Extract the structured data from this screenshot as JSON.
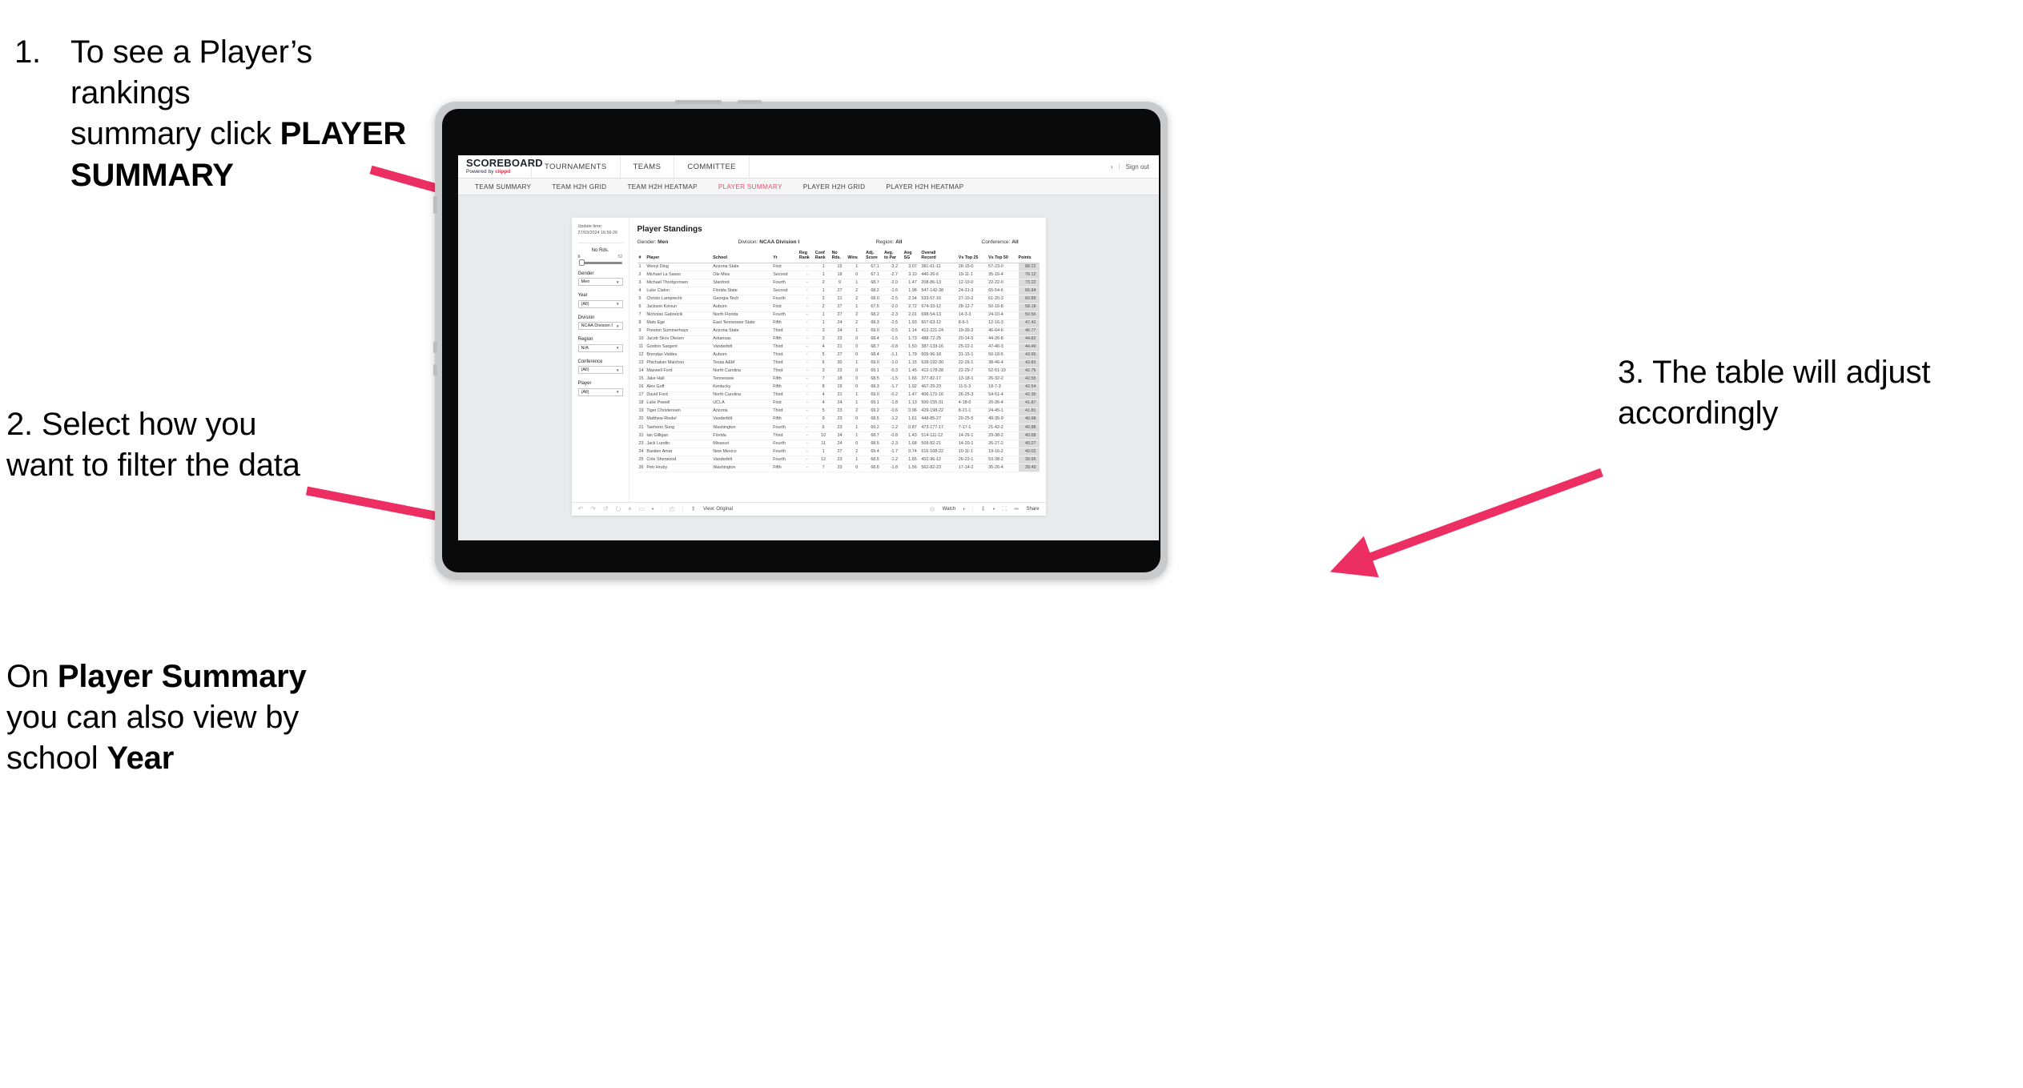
{
  "annotations": {
    "step1": {
      "number": "1.",
      "line1": "To see a Player’s rankings",
      "line2_pre": "summary click ",
      "line2_bold": "PLAYER",
      "line3_bold": "SUMMARY"
    },
    "step2": {
      "text": "2. Select how you want to filter the data"
    },
    "step2b": {
      "pre": "On ",
      "bold1": "Player Summary",
      "mid": " you can also view by school ",
      "bold2": "Year"
    },
    "step3": {
      "text": "3. The table will adjust accordingly"
    }
  },
  "colors": {
    "arrow": "#ED2E62",
    "accent": "#EF4D6E",
    "brand": "#E8334A"
  },
  "app": {
    "logo": {
      "main": "SCOREBOARD",
      "sub_pre": "Powered by ",
      "sub_brand": "clippd"
    },
    "top_nav": [
      "TOURNAMENTS",
      "TEAMS",
      "COMMITTEE"
    ],
    "header_right": {
      "user_glyph": "›",
      "divider": "|",
      "sign_out": "Sign out"
    },
    "sub_nav": [
      {
        "label": "TEAM SUMMARY",
        "active": false
      },
      {
        "label": "TEAM H2H GRID",
        "active": false
      },
      {
        "label": "TEAM H2H HEATMAP",
        "active": false
      },
      {
        "label": "PLAYER SUMMARY",
        "active": true
      },
      {
        "label": "PLAYER H2H GRID",
        "active": false
      },
      {
        "label": "PLAYER H2H HEATMAP",
        "active": false
      }
    ]
  },
  "filters": {
    "update_time_label": "Update time:",
    "update_time_value": "27/03/2024 16:56:26",
    "no_rds": {
      "label": "No Rds.",
      "min": "6",
      "max": "52"
    },
    "gender": {
      "label": "Gender",
      "value": "Men"
    },
    "year": {
      "label": "Year",
      "value": "(All)"
    },
    "division": {
      "label": "Division",
      "value": "NCAA Division I"
    },
    "region": {
      "label": "Region",
      "value": "N/A"
    },
    "conference": {
      "label": "Conference",
      "value": "(All)"
    },
    "player": {
      "label": "Player",
      "value": "(All)"
    }
  },
  "table": {
    "title": "Player Standings",
    "meta": [
      {
        "label": "Gender:",
        "value": "Men"
      },
      {
        "label": "Division:",
        "value": "NCAA Division I"
      },
      {
        "label": "Region:",
        "value": "All"
      },
      {
        "label": "Conference:",
        "value": "All"
      }
    ],
    "columns": [
      {
        "l1": "#",
        "l2": ""
      },
      {
        "l1": "Player",
        "l2": ""
      },
      {
        "l1": "School",
        "l2": ""
      },
      {
        "l1": "Yr",
        "l2": ""
      },
      {
        "l1": "Reg",
        "l2": "Rank"
      },
      {
        "l1": "Conf",
        "l2": "Rank"
      },
      {
        "l1": "No",
        "l2": "Rds."
      },
      {
        "l1": "Wins",
        "l2": ""
      },
      {
        "l1": "Adj.",
        "l2": "Score"
      },
      {
        "l1": "Avg.",
        "l2": "to Par"
      },
      {
        "l1": "Avg",
        "l2": "SG"
      },
      {
        "l1": "Overall",
        "l2": "Record"
      },
      {
        "l1": "Vs Top 25",
        "l2": ""
      },
      {
        "l1": "Vs Top 50",
        "l2": ""
      },
      {
        "l1": "Points",
        "l2": ""
      }
    ],
    "rows": [
      [
        "1",
        "Wenyi Ding",
        "Arizona State",
        "First",
        "-",
        "1",
        "15",
        "1",
        "67.1",
        "-3.2",
        "3.07",
        "381-61-11",
        "28-15-0",
        "57-23-0",
        "88.22"
      ],
      [
        "2",
        "Michael La Sasso",
        "Ole Miss",
        "Second",
        "-",
        "1",
        "18",
        "0",
        "67.1",
        "-2.7",
        "3.10",
        "440-26-6",
        "19-11-1",
        "35-16-4",
        "76.12"
      ],
      [
        "3",
        "Michael Thorbjornsen",
        "Stanford",
        "Fourth",
        "-",
        "2",
        "9",
        "1",
        "68.7",
        "-2.0",
        "1.47",
        "208-86-13",
        "12-10-0",
        "22-22-0",
        "73.22"
      ],
      [
        "4",
        "Luke Claton",
        "Florida State",
        "Second",
        "-",
        "1",
        "27",
        "2",
        "68.2",
        "-1.6",
        "1.98",
        "547-142-38",
        "24-31-3",
        "65-54-6",
        "66.94"
      ],
      [
        "5",
        "Christo Lamprecht",
        "Georgia Tech",
        "Fourth",
        "-",
        "2",
        "21",
        "2",
        "68.0",
        "-2.5",
        "2.34",
        "533-57-16",
        "27-10-2",
        "61-20-3",
        "60.89"
      ],
      [
        "6",
        "Jackson Koivun",
        "Auburn",
        "First",
        "-",
        "2",
        "27",
        "1",
        "67.5",
        "-2.0",
        "2.72",
        "674-33-12",
        "28-12-7",
        "50-16-8",
        "58.18"
      ],
      [
        "7",
        "Nicholas Gabrelcik",
        "North Florida",
        "Fourth",
        "-",
        "1",
        "27",
        "2",
        "68.2",
        "-2.3",
        "2.01",
        "698-54-13",
        "14-3-3",
        "24-10-4",
        "50.56"
      ],
      [
        "8",
        "Mats Ege",
        "East Tennessee State",
        "Fifth",
        "-",
        "1",
        "24",
        "2",
        "68.3",
        "-2.5",
        "1.93",
        "607-63-12",
        "8-6-1",
        "12-16-3",
        "47.42"
      ],
      [
        "9",
        "Preston Summerhays",
        "Arizona State",
        "Third",
        "-",
        "3",
        "24",
        "1",
        "69.0",
        "-0.5",
        "1.14",
        "412-221-24",
        "19-39-2",
        "46-64-6",
        "46.77"
      ],
      [
        "10",
        "Jacob Skov Olesen",
        "Arkansas",
        "Fifth",
        "-",
        "3",
        "23",
        "0",
        "68.4",
        "-1.5",
        "1.73",
        "488-72-25",
        "20-14-5",
        "44-26-8",
        "44.82"
      ],
      [
        "11",
        "Gordon Sargent",
        "Vanderbilt",
        "Third",
        "-",
        "4",
        "21",
        "0",
        "68.7",
        "-0.8",
        "1.50",
        "387-133-16",
        "25-22-1",
        "47-40-3",
        "44.49"
      ],
      [
        "12",
        "Brendan Valdes",
        "Auburn",
        "Third",
        "-",
        "5",
        "27",
        "0",
        "68.4",
        "-1.1",
        "1.79",
        "605-96-18",
        "31-15-1",
        "50-18-5",
        "43.95"
      ],
      [
        "13",
        "Phichaksn Maichon",
        "Texas A&M",
        "Third",
        "-",
        "6",
        "30",
        "1",
        "69.0",
        "-1.0",
        "1.15",
        "628-192-30",
        "22-26-1",
        "38-46-4",
        "43.83"
      ],
      [
        "14",
        "Maxwell Ford",
        "North Carolina",
        "Third",
        "-",
        "3",
        "23",
        "0",
        "69.1",
        "-0.3",
        "1.45",
        "412-178-28",
        "22-29-7",
        "52-51-10",
        "42.75"
      ],
      [
        "15",
        "Jake Hall",
        "Tennessee",
        "Fifth",
        "-",
        "7",
        "18",
        "0",
        "68.5",
        "-1.5",
        "1.66",
        "377-82-17",
        "13-18-1",
        "26-32-2",
        "42.55"
      ],
      [
        "16",
        "Alex Goff",
        "Kentucky",
        "Fifth",
        "-",
        "8",
        "19",
        "0",
        "68.3",
        "-1.7",
        "1.92",
        "467-29-23",
        "11-5-3",
        "18-7-3",
        "42.54"
      ],
      [
        "17",
        "David Ford",
        "North Carolina",
        "Third",
        "-",
        "4",
        "21",
        "1",
        "69.0",
        "-0.2",
        "1.47",
        "406-172-16",
        "26-25-3",
        "54-51-4",
        "42.35"
      ],
      [
        "18",
        "Luke Powell",
        "UCLA",
        "First",
        "-",
        "4",
        "24",
        "1",
        "69.1",
        "-1.8",
        "1.13",
        "500-155-31",
        "4-18-0",
        "20-36-4",
        "41.87"
      ],
      [
        "19",
        "Tiger Christensen",
        "Arizona",
        "Third",
        "-",
        "5",
        "23",
        "2",
        "69.2",
        "-0.6",
        "0.96",
        "429-198-22",
        "8-21-1",
        "24-45-1",
        "41.81"
      ],
      [
        "20",
        "Matthew Riedel",
        "Vanderbilt",
        "Fifth",
        "-",
        "9",
        "23",
        "0",
        "68.5",
        "-1.2",
        "1.61",
        "448-85-27",
        "20-25-5",
        "49-35-9",
        "40.98"
      ],
      [
        "21",
        "Taehoon Song",
        "Washington",
        "Fourth",
        "-",
        "6",
        "23",
        "1",
        "69.2",
        "-1.2",
        "0.87",
        "473-177-17",
        "7-17-1",
        "21-42-2",
        "40.88"
      ],
      [
        "22",
        "Ian Gilligan",
        "Florida",
        "Third",
        "-",
        "10",
        "24",
        "1",
        "68.7",
        "-0.8",
        "1.43",
        "514-111-12",
        "14-26-1",
        "29-38-2",
        "40.68"
      ],
      [
        "23",
        "Jack Lundin",
        "Missouri",
        "Fourth",
        "-",
        "11",
        "24",
        "0",
        "68.5",
        "-2.3",
        "1.68",
        "509-82-21",
        "14-20-1",
        "26-27-2",
        "40.27"
      ],
      [
        "24",
        "Bastien Amat",
        "New Mexico",
        "Fourth",
        "-",
        "1",
        "27",
        "2",
        "69.4",
        "-1.7",
        "0.74",
        "616-168-22",
        "10-11-1",
        "19-16-2",
        "40.02"
      ],
      [
        "25",
        "Cole Sherwood",
        "Vanderbilt",
        "Fourth",
        "-",
        "12",
        "23",
        "1",
        "68.5",
        "-1.2",
        "1.65",
        "452-96-12",
        "26-23-1",
        "53-38-2",
        "39.95"
      ],
      [
        "26",
        "Petr Hruby",
        "Washington",
        "Fifth",
        "-",
        "7",
        "23",
        "0",
        "68.6",
        "-1.8",
        "1.56",
        "562-82-23",
        "17-14-2",
        "35-26-4",
        "39.49"
      ]
    ]
  },
  "toolbar": {
    "undo": "↶",
    "redo": "↷",
    "revert": "↺",
    "refresh": "⭮",
    "pause": "⏸",
    "rect": "▭",
    "caret": "▾",
    "sep": "|",
    "clock": "◴",
    "view_icon": "⬆",
    "view_label": "View: Original",
    "watch_icon": "◎",
    "watch_label": "Watch",
    "watch_caret": "▾",
    "download_icon": "⬇",
    "download_caret": "▾",
    "fullscreen_icon": "⛶",
    "share_icon": "➦",
    "share_label": "Share"
  }
}
